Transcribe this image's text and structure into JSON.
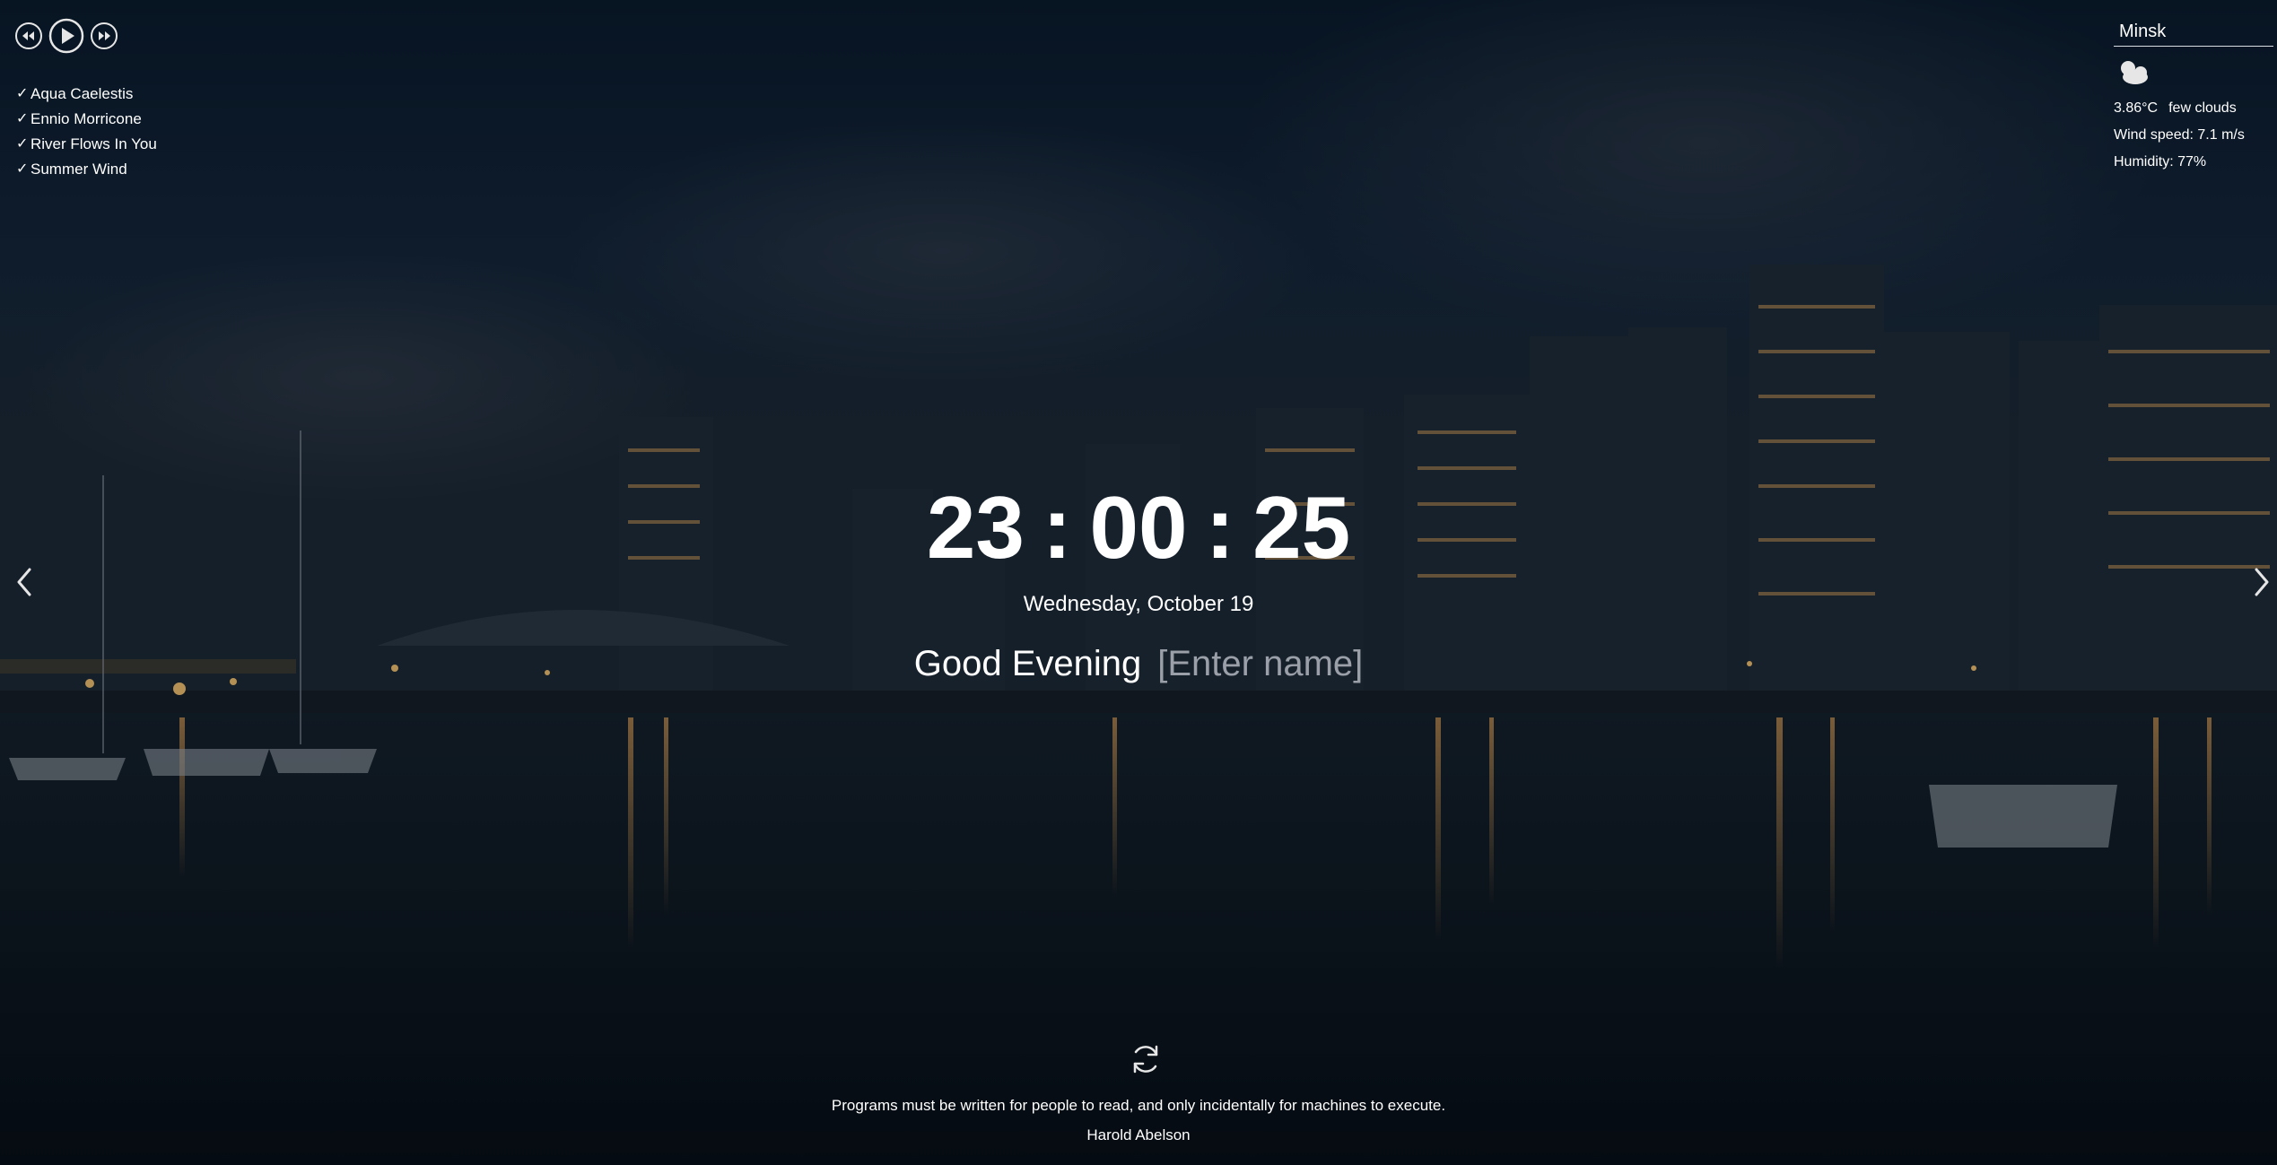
{
  "player": {
    "buttons": [
      "previous-track",
      "play",
      "next-track"
    ],
    "playlist": [
      {
        "title": "Aqua Caelestis",
        "mark": "✓"
      },
      {
        "title": "Ennio Morricone",
        "mark": "✓"
      },
      {
        "title": "River Flows In You",
        "mark": "✓"
      },
      {
        "title": "Summer Wind",
        "mark": "✓"
      }
    ]
  },
  "weather": {
    "city": "Minsk",
    "icon": "few-clouds-night-icon",
    "temperature": "3.86°C",
    "description": "few clouds",
    "wind": "Wind speed: 7.1 m/s",
    "humidity": "Humidity: 77%"
  },
  "clock": {
    "hours": "23",
    "minutes": "00",
    "seconds": "25",
    "separator": ":"
  },
  "date": "Wednesday, October 19",
  "greeting": {
    "text": "Good Evening",
    "name": "[Enter name]"
  },
  "slider": {
    "prev_icon": "chevron-left-icon",
    "next_icon": "chevron-right-icon"
  },
  "quote": {
    "refresh_icon": "refresh-icon",
    "text": "Programs must be written for people to read, and only incidentally for machines to execute.",
    "author": "Harold Abelson"
  },
  "colors": {
    "sky_top": "#0b1c30",
    "water": "#0a1624",
    "accent_text": "#ffffff",
    "placeholder": "#9a9fa8"
  }
}
